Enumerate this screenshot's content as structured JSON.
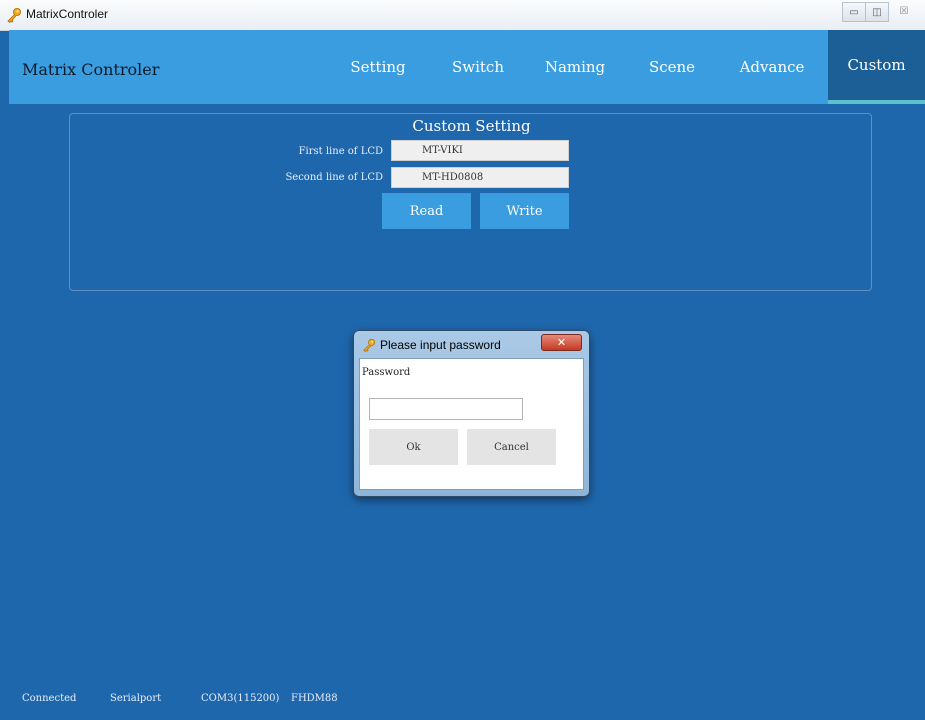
{
  "window": {
    "title": "MatrixControler",
    "app_icon": "key-icon",
    "controls": {
      "minimize": "▭",
      "restore": "◫",
      "close": "☒"
    }
  },
  "navbar": {
    "brand": "Matrix Controler",
    "tabs": [
      {
        "label": "Setting"
      },
      {
        "label": "Switch"
      },
      {
        "label": "Naming"
      },
      {
        "label": "Scene"
      },
      {
        "label": "Advance"
      },
      {
        "label": "Custom",
        "active": true
      }
    ]
  },
  "custom_setting": {
    "title": "Custom Setting",
    "first_line_label": "First line of LCD",
    "first_line_value": "MT-VIKI",
    "second_line_label": "Second line of LCD",
    "second_line_value": "MT-HD0808",
    "read_label": "Read",
    "write_label": "Write"
  },
  "password_dialog": {
    "title": "Please input password",
    "close_glyph": "✕",
    "field_label": "Password",
    "password_value": "",
    "ok_label": "Ok",
    "cancel_label": "Cancel"
  },
  "status_bar": {
    "connection": "Connected",
    "port_type": "Serialport",
    "port": "COM3(115200)",
    "device": "FHDM88"
  },
  "colors": {
    "background": "#1f67ad",
    "navbar": "#3a9de0",
    "active_tab": "#1c5e96",
    "active_tab_underline": "#59c3c9"
  }
}
